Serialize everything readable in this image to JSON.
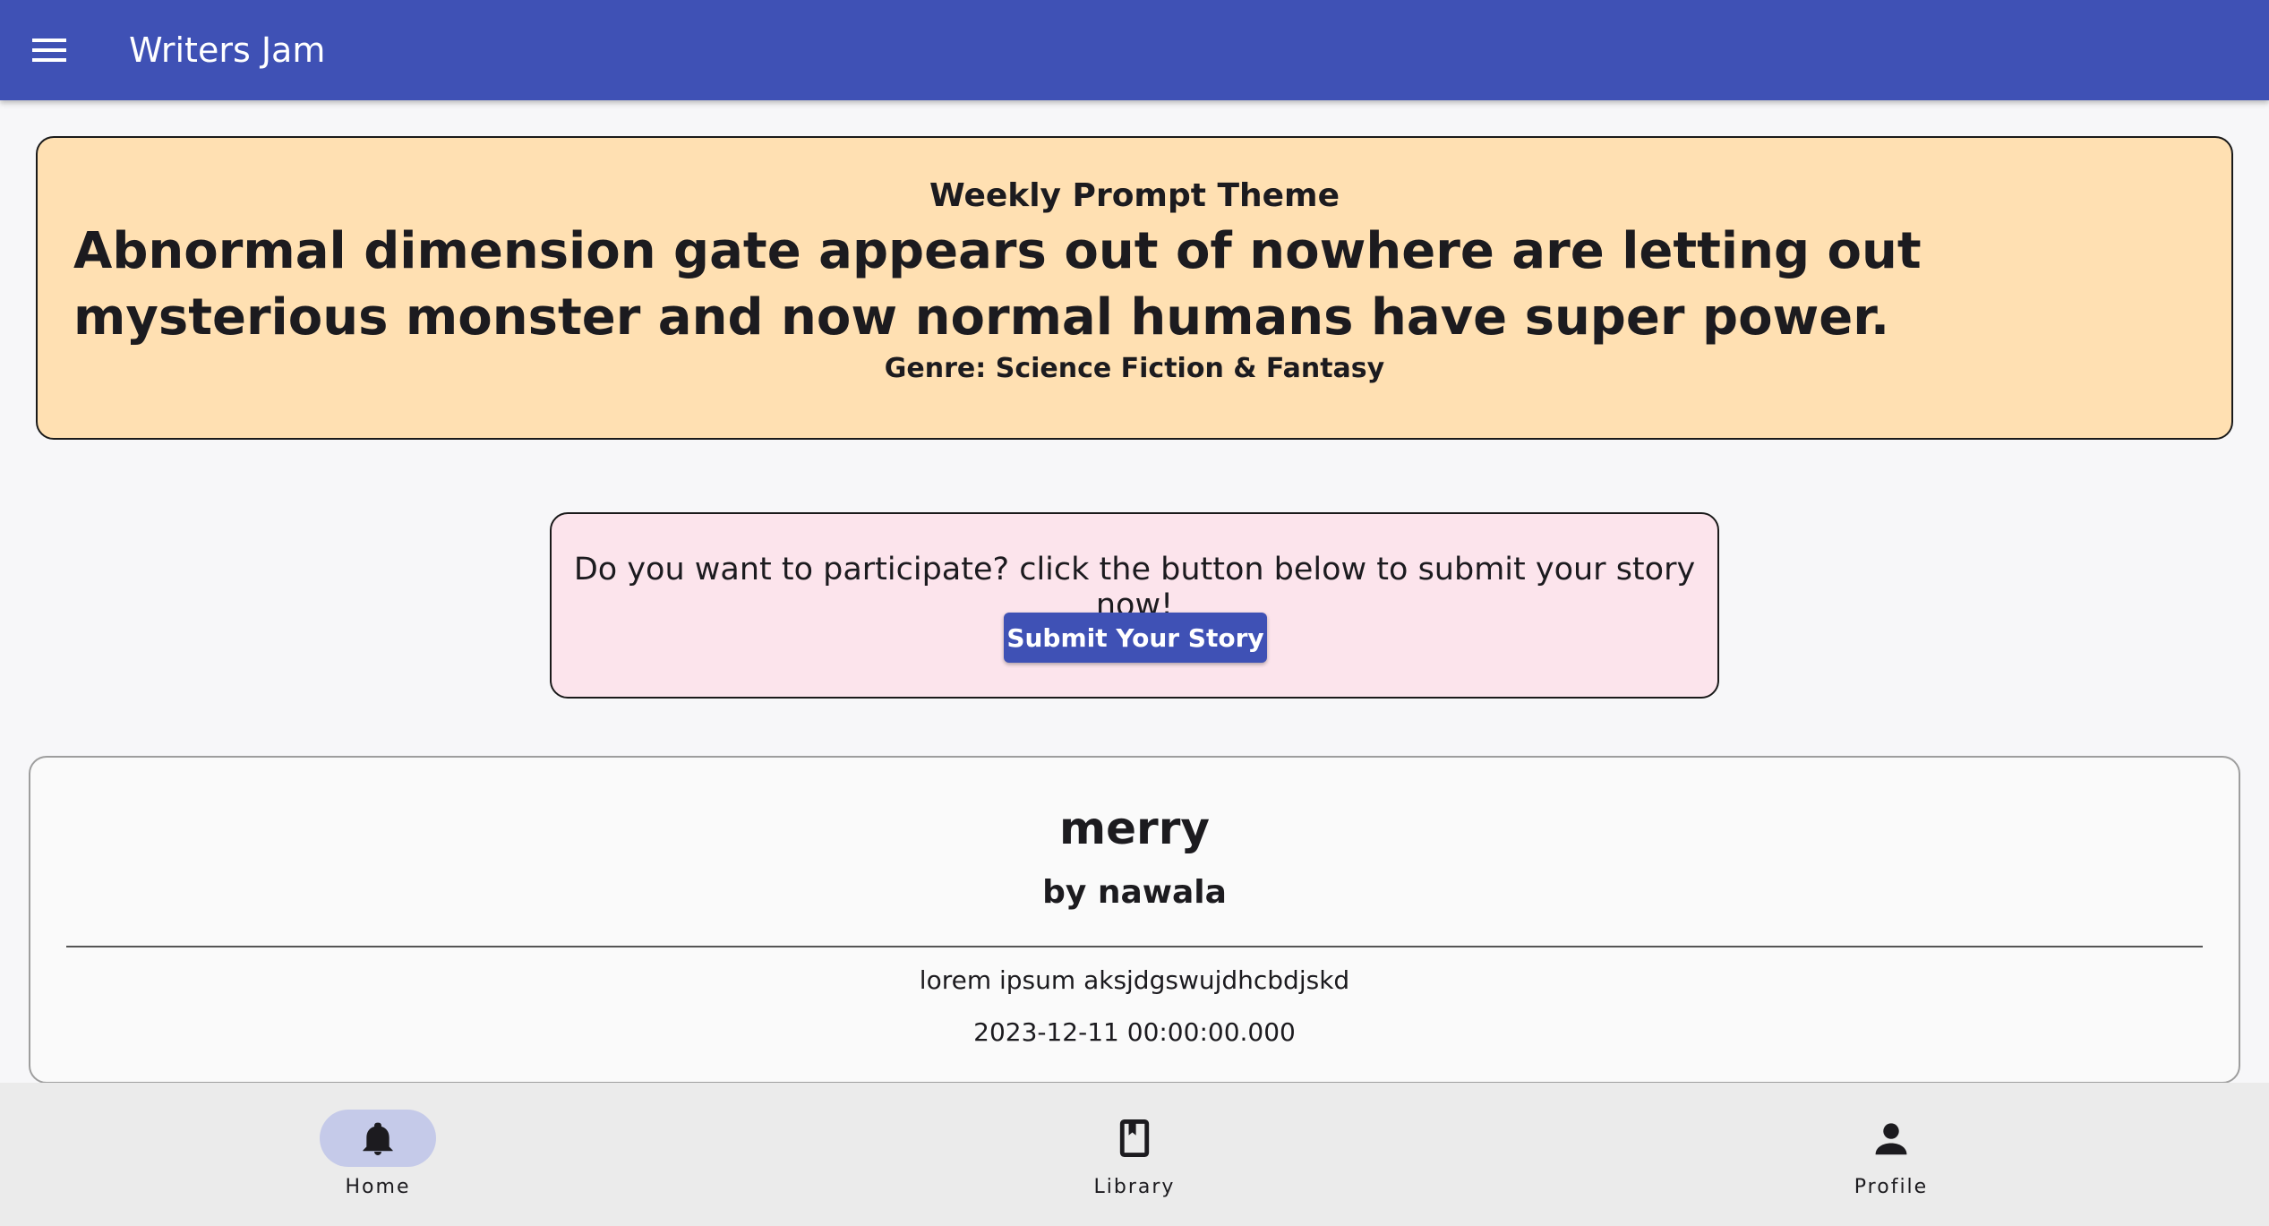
{
  "appbar": {
    "title": "Writers Jam",
    "menu_icon": "menu-icon",
    "color": "#3f51b5"
  },
  "prompt": {
    "label": "Weekly Prompt Theme",
    "text": "Abnormal dimension gate appears out of nowhere are letting out mysterious monster and now normal humans have super power.",
    "genre": "Genre: Science Fiction & Fantasy",
    "background": "#ffe0b2"
  },
  "participate": {
    "text": "Do you want to participate? click the button below to submit your story now!",
    "button_label": "Submit Your Story",
    "background": "#fce4ec"
  },
  "story": {
    "title": "merry",
    "author": "by nawala",
    "excerpt": "lorem ipsum aksjdgswujdhcbdjskd",
    "date": "2023-12-11 00:00:00.000"
  },
  "bottom_nav": {
    "items": [
      {
        "label": "Home",
        "icon": "bell-icon",
        "active": true
      },
      {
        "label": "Library",
        "icon": "book-icon",
        "active": false
      },
      {
        "label": "Profile",
        "icon": "person-icon",
        "active": false
      }
    ],
    "active_indicator_color": "#c5cae9"
  }
}
